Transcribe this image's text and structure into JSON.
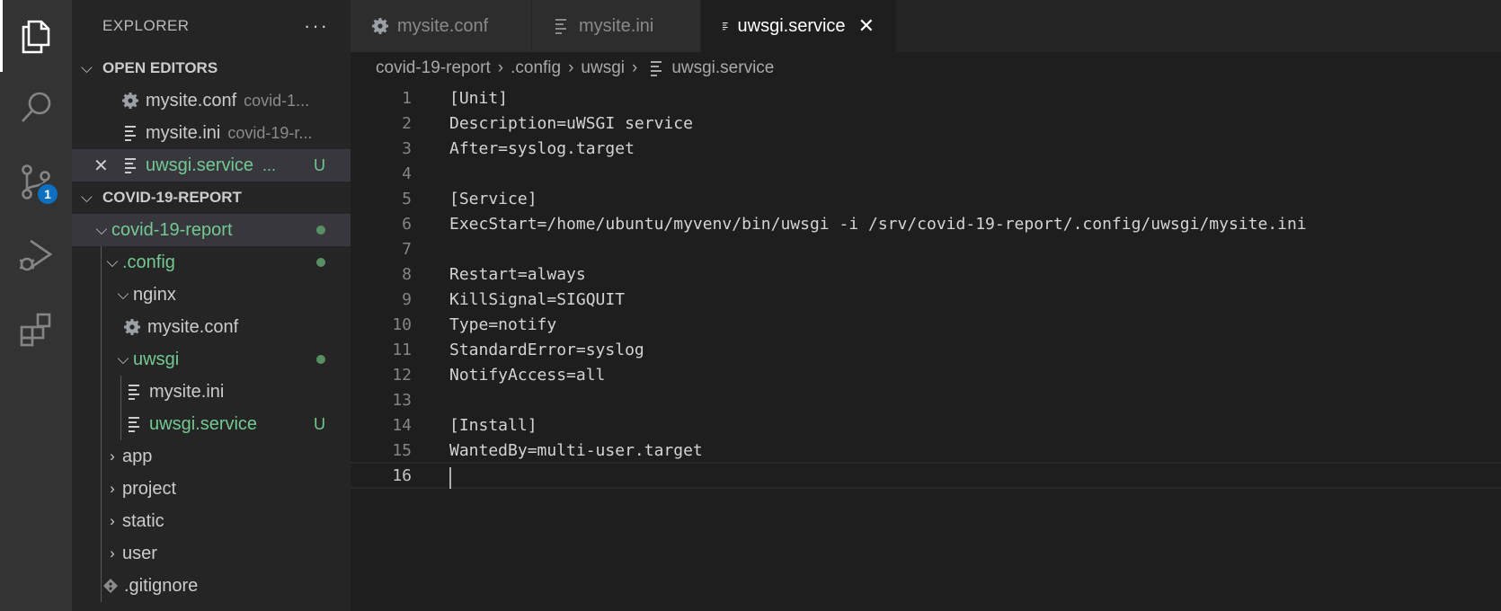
{
  "explorer": {
    "title": "EXPLORER",
    "more": "···",
    "open_editors": {
      "label": "OPEN EDITORS",
      "items": [
        {
          "name": "mysite.conf",
          "desc": "covid-1..."
        },
        {
          "name": "mysite.ini",
          "desc": "covid-19-r..."
        },
        {
          "name": "uwsgi.service",
          "desc": "...",
          "status": "U"
        }
      ]
    },
    "project": {
      "label": "COVID-19-REPORT",
      "tree": {
        "root": "covid-19-report",
        "config": ".config",
        "nginx": "nginx",
        "nginx_conf": "mysite.conf",
        "uwsgi": "uwsgi",
        "uwsgi_ini": "mysite.ini",
        "uwsgi_service": "uwsgi.service",
        "uwsgi_service_status": "U",
        "app": "app",
        "project": "project",
        "static": "static",
        "user": "user",
        "gitignore": ".gitignore"
      }
    }
  },
  "activity": {
    "scm_badge": "1",
    "icons": [
      "files-icon",
      "search-icon",
      "source-control-icon",
      "run-debug-icon",
      "extensions-icon"
    ]
  },
  "tabs": [
    {
      "label": "mysite.conf",
      "icon": "gear-icon"
    },
    {
      "label": "mysite.ini",
      "icon": "lines-icon"
    },
    {
      "label": "uwsgi.service",
      "icon": "lines-icon",
      "active": true,
      "close": "✕"
    }
  ],
  "breadcrumb": {
    "parts": [
      "covid-19-report",
      ".config",
      "uwsgi",
      "uwsgi.service"
    ]
  },
  "editor": {
    "lines": [
      "[Unit]",
      "Description=uWSGI service",
      "After=syslog.target",
      "",
      "[Service]",
      "ExecStart=/home/ubuntu/myvenv/bin/uwsgi -i /srv/covid-19-report/.config/uwsgi/mysite.ini",
      "",
      "Restart=always",
      "KillSignal=SIGQUIT",
      "Type=notify",
      "StandardError=syslog",
      "NotifyAccess=all",
      "",
      "[Install]",
      "WantedBy=multi-user.target",
      ""
    ],
    "line_numbers": [
      "1",
      "2",
      "3",
      "4",
      "5",
      "6",
      "7",
      "8",
      "9",
      "10",
      "11",
      "12",
      "13",
      "14",
      "15",
      "16"
    ],
    "current_line": 16
  }
}
